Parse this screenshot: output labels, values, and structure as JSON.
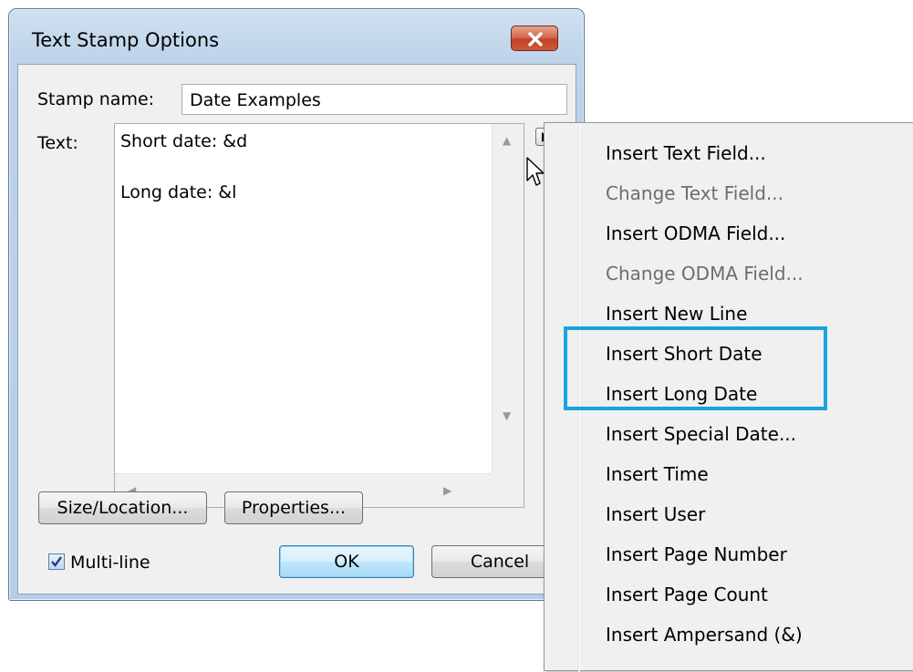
{
  "dialog": {
    "title": "Text Stamp Options",
    "stamp_name_label": "Stamp name:",
    "stamp_name_value": "Date Examples",
    "text_label": "Text:",
    "text_lines": [
      "Short date: &d",
      "Long date: &l"
    ],
    "size_location_button": "Size/Location...",
    "properties_button": "Properties...",
    "multiline_label": "Multi-line",
    "multiline_checked": true,
    "ok_button": "OK",
    "cancel_button": "Cancel"
  },
  "menu": {
    "items": [
      {
        "label": "Insert Text Field...",
        "enabled": true
      },
      {
        "label": "Change Text Field...",
        "enabled": false
      },
      {
        "label": "Insert ODMA Field...",
        "enabled": true
      },
      {
        "label": "Change ODMA Field...",
        "enabled": false
      },
      {
        "label": "Insert New Line",
        "enabled": true
      },
      {
        "label": "Insert Short Date",
        "enabled": true
      },
      {
        "label": "Insert Long Date",
        "enabled": true
      },
      {
        "label": "Insert Special Date...",
        "enabled": true
      },
      {
        "label": "Insert Time",
        "enabled": true
      },
      {
        "label": "Insert User",
        "enabled": true
      },
      {
        "label": "Insert Page Number",
        "enabled": true
      },
      {
        "label": "Insert Page Count",
        "enabled": true
      },
      {
        "label": "Insert Ampersand (&)",
        "enabled": true
      }
    ]
  },
  "colors": {
    "highlight_border": "#1aa3dd",
    "disabled_text": "#6d6d6d"
  }
}
